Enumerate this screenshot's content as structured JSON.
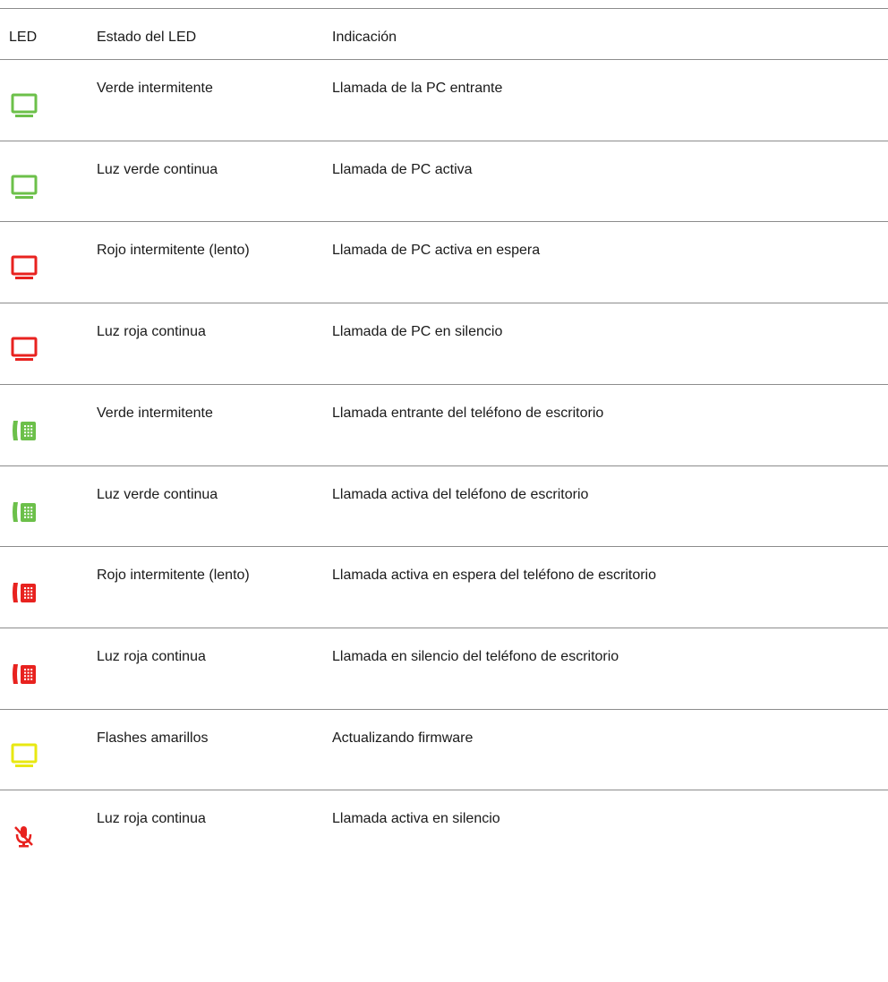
{
  "table": {
    "headers": {
      "led": "LED",
      "state": "Estado del LED",
      "indication": "Indicación"
    },
    "rows": [
      {
        "icon": "monitor-icon",
        "color": "#6cc04a",
        "state": "Verde intermitente",
        "indication": "Llamada de la PC entrante"
      },
      {
        "icon": "monitor-icon",
        "color": "#6cc04a",
        "state": "Luz verde continua",
        "indication": "Llamada de PC activa"
      },
      {
        "icon": "monitor-icon",
        "color": "#e8221f",
        "state": "Rojo intermitente (lento)",
        "indication": "Llamada de PC activa en espera"
      },
      {
        "icon": "monitor-icon",
        "color": "#e8221f",
        "state": "Luz roja continua",
        "indication": "Llamada de PC en silencio"
      },
      {
        "icon": "desk-phone-icon",
        "color": "#6cc04a",
        "state": "Verde intermitente",
        "indication": "Llamada entrante del teléfono de escritorio"
      },
      {
        "icon": "desk-phone-icon",
        "color": "#6cc04a",
        "state": "Luz verde continua",
        "indication": "Llamada activa del teléfono de escritorio"
      },
      {
        "icon": "desk-phone-icon",
        "color": "#e8221f",
        "state": "Rojo intermitente (lento)",
        "indication": "Llamada activa en espera del teléfono de escritorio"
      },
      {
        "icon": "desk-phone-icon",
        "color": "#e8221f",
        "state": "Luz roja continua",
        "indication": "Llamada en silencio del teléfono de escritorio"
      },
      {
        "icon": "monitor-icon",
        "color": "#e8e812",
        "state": "Flashes amarillos",
        "indication": "Actualizando firmware"
      },
      {
        "icon": "mic-muted-icon",
        "color": "#e8221f",
        "state": "Luz roja continua",
        "indication": "Llamada activa en silencio"
      }
    ]
  }
}
